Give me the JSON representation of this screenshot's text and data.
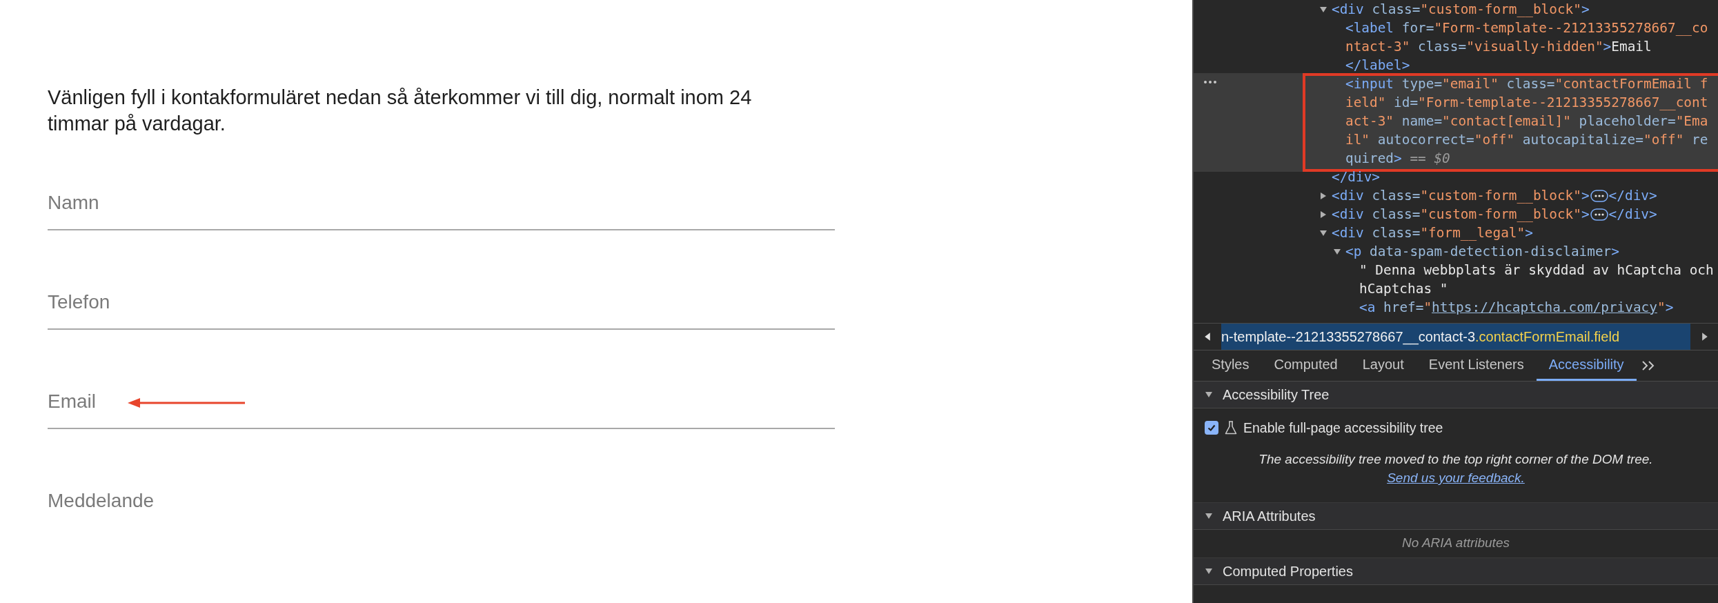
{
  "page": {
    "intro": "Vänligen fyll i kontakformuläret nedan så återkommer vi till dig, normalt inom 24 timmar på vardagar.",
    "fields": [
      {
        "kind": "input",
        "placeholder": "Namn",
        "annotated": false
      },
      {
        "kind": "input",
        "placeholder": "Telefon",
        "annotated": false
      },
      {
        "kind": "input",
        "placeholder": "Email",
        "annotated": true
      },
      {
        "kind": "textarea",
        "placeholder": "Meddelande",
        "annotated": false
      }
    ]
  },
  "devtools": {
    "tree": [
      {
        "expanded": true,
        "selected": false,
        "annotated": false,
        "tokens": [
          {
            "kind": "tag",
            "text": "<div"
          },
          {
            "kind": "attr",
            "text": " class="
          },
          {
            "kind": "value",
            "text": "\"custom-form__block\""
          },
          {
            "kind": "tag",
            "text": ">"
          }
        ],
        "children": [
          {
            "selected": false,
            "annotated": false,
            "tokens": [
              {
                "kind": "tag",
                "text": "<label"
              },
              {
                "kind": "attr",
                "text": " for="
              },
              {
                "kind": "value",
                "text": "\"Form-template--21213355278667__contact-3\""
              },
              {
                "kind": "attr",
                "text": " class="
              },
              {
                "kind": "value",
                "text": "\"visually-hidden\""
              },
              {
                "kind": "tag",
                "text": ">"
              },
              {
                "kind": "text",
                "text": "Email"
              }
            ],
            "close": [
              {
                "kind": "tag",
                "text": "</label>"
              }
            ]
          },
          {
            "selected": true,
            "annotated": true,
            "tokens": [
              {
                "kind": "tag",
                "text": "<input"
              },
              {
                "kind": "attr",
                "text": " type="
              },
              {
                "kind": "value",
                "text": "\"email\""
              },
              {
                "kind": "attr",
                "text": " class="
              },
              {
                "kind": "value",
                "text": "\"contactFormEmail field\""
              },
              {
                "kind": "attr",
                "text": " id="
              },
              {
                "kind": "value",
                "text": "\"Form-template--21213355278667__contact-3\""
              },
              {
                "kind": "attr",
                "text": " name="
              },
              {
                "kind": "value",
                "text": "\"contact[email]\""
              },
              {
                "kind": "attr",
                "text": " placeholder="
              },
              {
                "kind": "value",
                "text": "\"Email\""
              },
              {
                "kind": "attr",
                "text": " autocorrect="
              },
              {
                "kind": "value",
                "text": "\"off\""
              },
              {
                "kind": "attr",
                "text": " autocapitalize="
              },
              {
                "kind": "value",
                "text": "\"off\""
              },
              {
                "kind": "attr",
                "text": " required"
              },
              {
                "kind": "tag",
                "text": ">"
              },
              {
                "kind": "marker",
                "text": " == $0"
              }
            ]
          }
        ],
        "close": [
          {
            "kind": "tag",
            "text": "</div>"
          }
        ]
      },
      {
        "expanded": false,
        "selected": false,
        "annotated": false,
        "tokens": [
          {
            "kind": "tag",
            "text": "<div"
          },
          {
            "kind": "attr",
            "text": " class="
          },
          {
            "kind": "value",
            "text": "\"custom-form__block\""
          },
          {
            "kind": "tag",
            "text": ">"
          },
          {
            "kind": "badge"
          },
          {
            "kind": "tag",
            "text": "</div>"
          }
        ]
      },
      {
        "expanded": false,
        "selected": false,
        "annotated": false,
        "tokens": [
          {
            "kind": "tag",
            "text": "<div"
          },
          {
            "kind": "attr",
            "text": " class="
          },
          {
            "kind": "value",
            "text": "\"custom-form__block\""
          },
          {
            "kind": "tag",
            "text": ">"
          },
          {
            "kind": "badge"
          },
          {
            "kind": "tag",
            "text": "</div>"
          }
        ]
      },
      {
        "expanded": true,
        "selected": false,
        "annotated": false,
        "tokens": [
          {
            "kind": "tag",
            "text": "<div"
          },
          {
            "kind": "attr",
            "text": " class="
          },
          {
            "kind": "value",
            "text": "\"form__legal\""
          },
          {
            "kind": "tag",
            "text": ">"
          }
        ],
        "children": [
          {
            "expanded": true,
            "selected": false,
            "annotated": false,
            "tokens": [
              {
                "kind": "tag",
                "text": "<p"
              },
              {
                "kind": "attr",
                "text": " data-spam-detection-disclaimer"
              },
              {
                "kind": "tag",
                "text": ">"
              }
            ],
            "children": [
              {
                "selected": false,
                "annotated": false,
                "tokens": [
                  {
                    "kind": "text",
                    "text": "\" Denna webbplats är skyddad av hCaptcha och hCaptchas \""
                  }
                ]
              },
              {
                "selected": false,
                "annotated": false,
                "tokens": [
                  {
                    "kind": "tag",
                    "text": "<a"
                  },
                  {
                    "kind": "attr",
                    "text": " href="
                  },
                  {
                    "kind": "value",
                    "text": "\""
                  },
                  {
                    "kind": "link",
                    "text": "https://hcaptcha.com/privacy"
                  },
                  {
                    "kind": "value",
                    "text": "\""
                  },
                  {
                    "kind": "tag",
                    "text": ">"
                  }
                ]
              }
            ]
          }
        ]
      }
    ],
    "breadcrumb": {
      "path": "n-template--21213355278667__contact-3",
      "selector": ".contactFormEmail.field"
    },
    "tabs": [
      {
        "label": "Styles",
        "selected": false
      },
      {
        "label": "Computed",
        "selected": false
      },
      {
        "label": "Layout",
        "selected": false
      },
      {
        "label": "Event Listeners",
        "selected": false
      },
      {
        "label": "Accessibility",
        "selected": true
      }
    ],
    "sections": [
      {
        "kind": "settings",
        "title": "Accessibility Tree",
        "expanded": true,
        "checkbox": {
          "label": "Enable full-page accessibility tree",
          "checked": true
        },
        "note": "The accessibility tree moved to the top right corner of the DOM tree.",
        "link": "Send us your feedback."
      },
      {
        "kind": "empty",
        "title": "ARIA Attributes",
        "expanded": true,
        "empty_text": "No ARIA attributes"
      },
      {
        "kind": "plain",
        "title": "Computed Properties",
        "expanded": true
      }
    ]
  }
}
